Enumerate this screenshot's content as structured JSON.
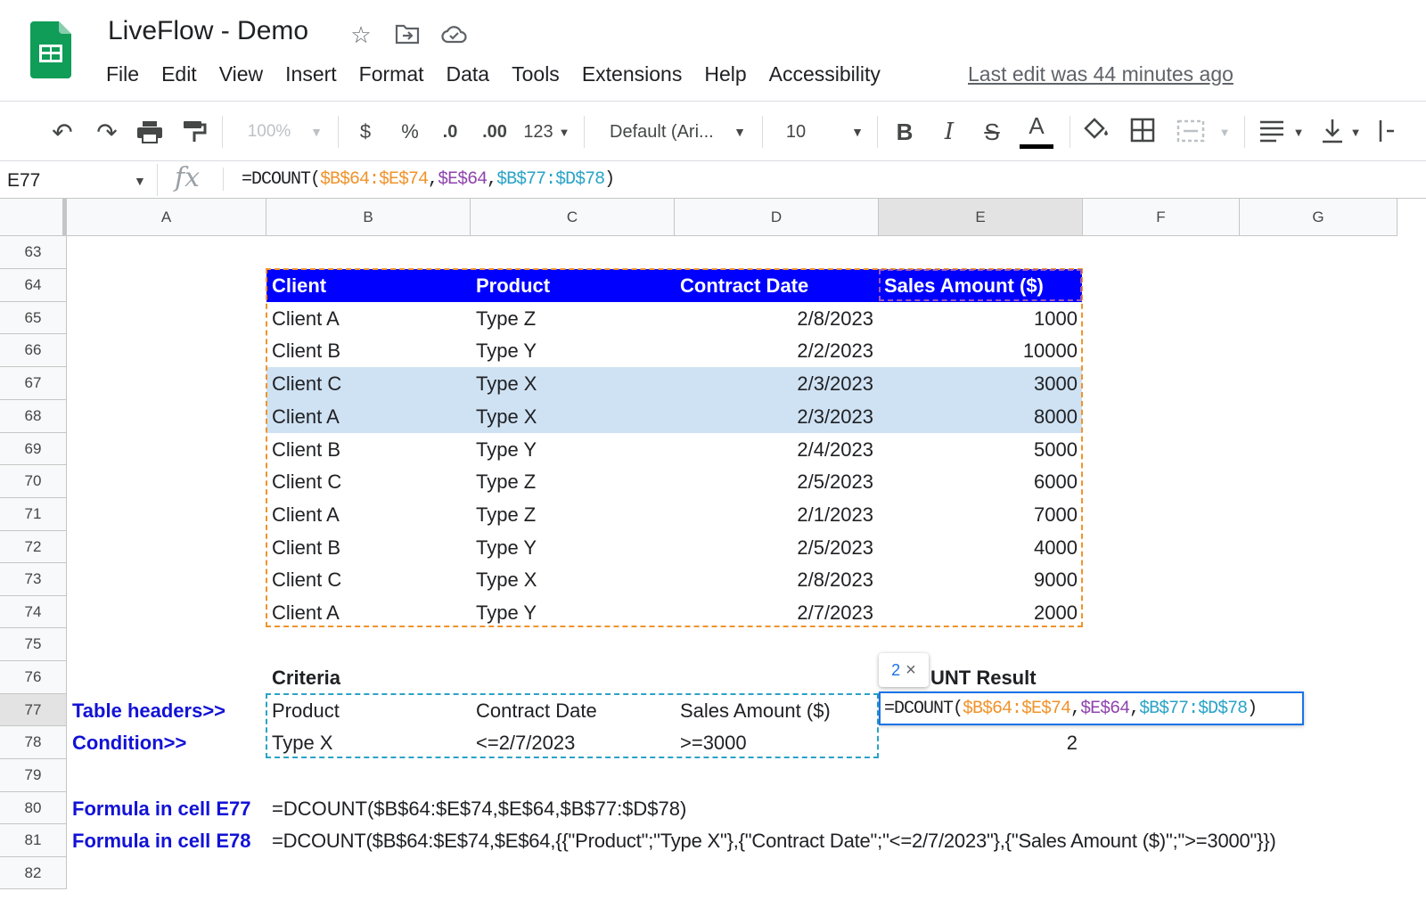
{
  "app": {
    "title": "LiveFlow - Demo",
    "last_edit": "Last edit was 44 minutes ago",
    "menu": [
      "File",
      "Edit",
      "View",
      "Insert",
      "Format",
      "Data",
      "Tools",
      "Extensions",
      "Help",
      "Accessibility"
    ]
  },
  "toolbar": {
    "zoom": "100%",
    "currency": "$",
    "percent": "%",
    "dec_decrease": ".0",
    "dec_increase": ".00",
    "number_format": "123",
    "font": "Default (Ari...",
    "font_size": "10",
    "bold": "B",
    "italic": "I",
    "strike": "S",
    "text_color": "A"
  },
  "formula_bar": {
    "name_box": "E77",
    "fx": "fx",
    "prefix": "=DCOUNT(",
    "arg1": "$B$64:$E$74",
    "comma1": ",",
    "arg2": "$E$64",
    "comma2": ",",
    "arg3": "$B$77:$D$78",
    "suffix": ")"
  },
  "columns": [
    "A",
    "B",
    "C",
    "D",
    "E",
    "F",
    "G"
  ],
  "rows": [
    "63",
    "64",
    "65",
    "66",
    "67",
    "68",
    "69",
    "70",
    "71",
    "72",
    "73",
    "74",
    "75",
    "76",
    "77",
    "78",
    "79",
    "80",
    "81",
    "82"
  ],
  "table": {
    "headers": [
      "Client",
      "Product",
      "Contract Date",
      "Sales Amount ($)"
    ],
    "rows": [
      [
        "Client A",
        "Type Z",
        "2/8/2023",
        "1000"
      ],
      [
        "Client B",
        "Type Y",
        "2/2/2023",
        "10000"
      ],
      [
        "Client C",
        "Type X",
        "2/3/2023",
        "3000"
      ],
      [
        "Client A",
        "Type X",
        "2/3/2023",
        "8000"
      ],
      [
        "Client B",
        "Type Y",
        "2/4/2023",
        "5000"
      ],
      [
        "Client C",
        "Type Z",
        "2/5/2023",
        "6000"
      ],
      [
        "Client A",
        "Type Z",
        "2/1/2023",
        "7000"
      ],
      [
        "Client B",
        "Type Y",
        "2/5/2023",
        "4000"
      ],
      [
        "Client C",
        "Type X",
        "2/8/2023",
        "9000"
      ],
      [
        "Client A",
        "Type Y",
        "2/7/2023",
        "2000"
      ]
    ]
  },
  "criteria": {
    "title": "Criteria",
    "result_title_visible": "UNT Result",
    "headers_label": "Table headers>>",
    "condition_label": "Condition>>",
    "headers": [
      "Product",
      "Contract Date",
      "Sales Amount ($)"
    ],
    "conditions": [
      "Type X",
      "<=2/7/2023",
      ">=3000"
    ],
    "result_value": "2",
    "tip_value": "2",
    "tip_close": "×"
  },
  "notes": {
    "label1": "Formula in cell E77",
    "formula1": "=DCOUNT($B$64:$E$74,$E$64,$B$77:$D$78)",
    "label2": "Formula in cell E78",
    "formula2": "=DCOUNT($B$64:$E$74,$E$64,{{\"Product\";\"Type X\"},{\"Contract Date\";\"<=2/7/2023\"},{\"Sales Amount ($)\";\">=3000\"}})"
  },
  "colors": {
    "header_blue": "#0000ff",
    "band": "#cfe2f3",
    "orange": "#f0932b",
    "purple": "#8e44ad",
    "teal": "#2aa3c6",
    "label_blue": "#1212d6"
  }
}
